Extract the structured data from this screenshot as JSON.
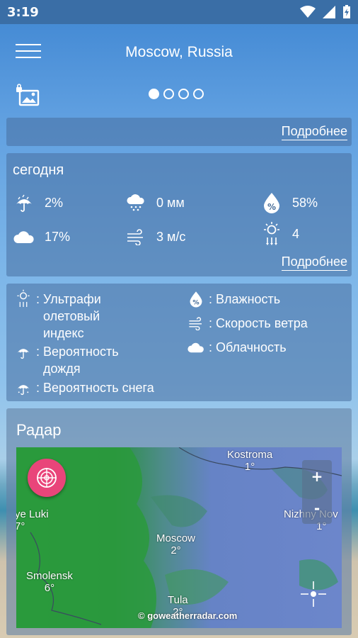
{
  "status": {
    "time": "3:19"
  },
  "header": {
    "city": "Moscow, Russia"
  },
  "pager": {
    "count": 4,
    "active": 0
  },
  "card_top": {
    "more": "Подробнее"
  },
  "today": {
    "title": "сегодня",
    "rain_prob": "2%",
    "precip": "0 мм",
    "humidity": "58%",
    "clouds": "17%",
    "wind": "3 м/с",
    "uv": "4",
    "more": "Подробнее"
  },
  "legend": {
    "uv_line1": ": Ультрафи",
    "uv_line2": "олетовый",
    "uv_line3": "индекс",
    "rain_line1": ": Вероятность",
    "rain_line2": "дождя",
    "snow": ": Вероятность снега",
    "humidity": ": Влажность",
    "wind": ": Скорость ветра",
    "clouds": ": Облачность"
  },
  "radar": {
    "title": "Радар",
    "zoom_in": "+",
    "zoom_out": "-",
    "copyright": "© goweatherradar.com",
    "cities": [
      {
        "name": "Kostroma",
        "temp": "1°"
      },
      {
        "name": "Nizhny Nov",
        "temp": "1°"
      },
      {
        "name": "ye Luki",
        "temp": "7°"
      },
      {
        "name": "Moscow",
        "temp": "2°"
      },
      {
        "name": "Smolensk",
        "temp": "6°"
      },
      {
        "name": "Tula",
        "temp": "2°"
      }
    ]
  }
}
